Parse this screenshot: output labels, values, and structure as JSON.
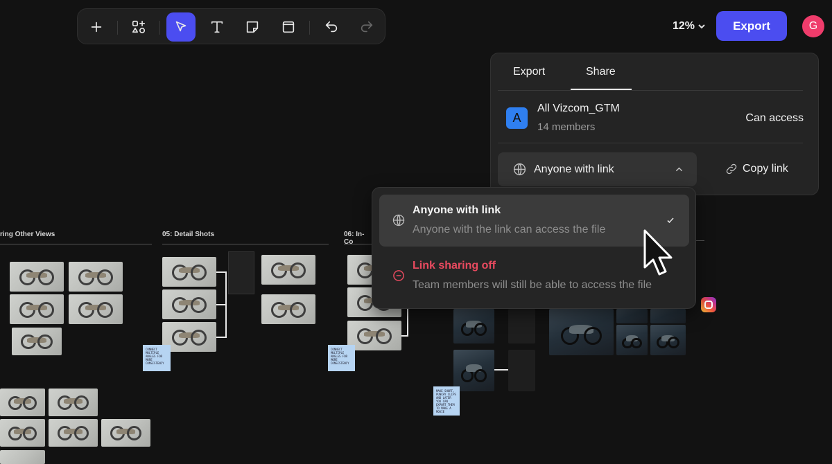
{
  "toolbar": {
    "tools": [
      "add-icon",
      "shapes-icon",
      "select-pointer-icon",
      "text-icon",
      "sticky-note-icon",
      "frame-icon",
      "undo-icon",
      "redo-icon"
    ],
    "active_tool": "select-pointer-icon"
  },
  "header": {
    "zoom": "12%",
    "export_label": "Export",
    "avatar_initial": "G"
  },
  "share_panel": {
    "tabs": [
      "Export",
      "Share"
    ],
    "active_tab": "Share",
    "team": {
      "badge": "A",
      "name": "All Vizcom_GTM",
      "members": "14 members",
      "access": "Can access"
    },
    "link_select": {
      "label": "Anyone with link"
    },
    "copy_link_label": "Copy link"
  },
  "dropdown": {
    "options": [
      {
        "title": "Anyone with link",
        "desc": "Anyone with the link can access the file",
        "selected": true
      },
      {
        "title": "Link sharing off",
        "desc": "Team members will still be able to access the file",
        "selected": false
      }
    ]
  },
  "canvas": {
    "frames": [
      "ring Other Views",
      "05: Detail Shots",
      "06: In-Co"
    ],
    "sticky_notes": [
      "Connect multiple angles for more consistency",
      "Connect multiple angles for more consistency",
      "Make short, punchy clips and later you can export them to make a movie"
    ]
  },
  "colors": {
    "accent": "#4b4df0",
    "avatar": "#ef3c6b",
    "team_badge": "#2f7ff0",
    "danger": "#e84a5f"
  }
}
